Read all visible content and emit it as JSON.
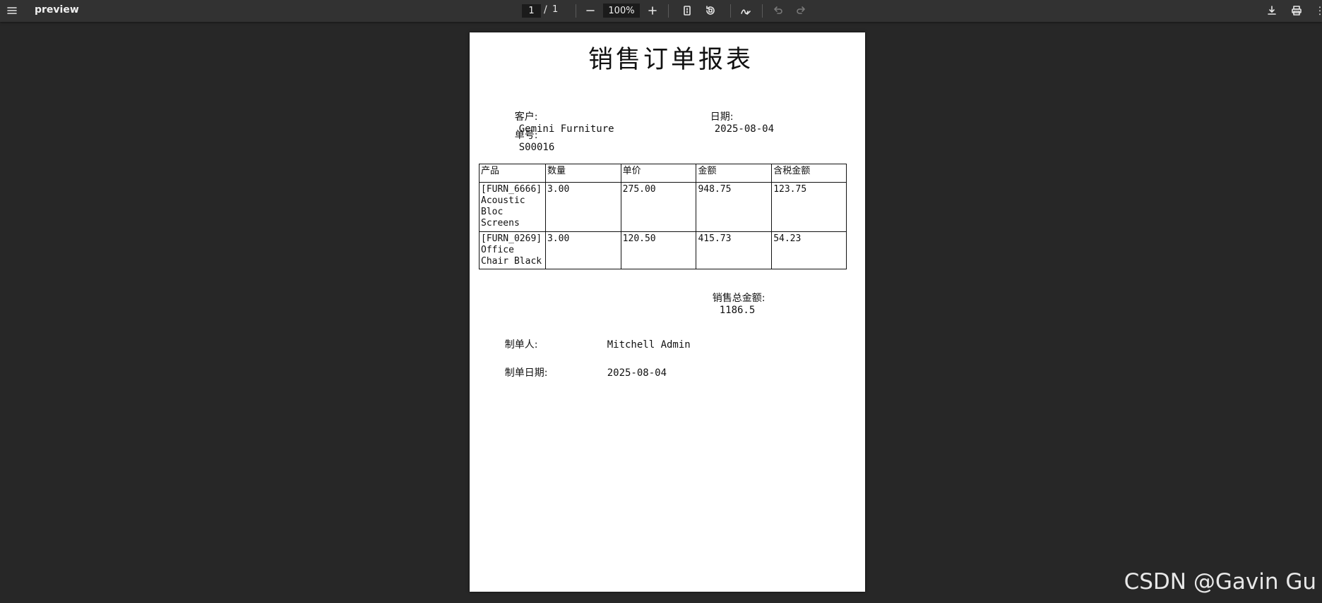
{
  "viewer": {
    "title": "preview",
    "current_page": "1",
    "page_separator": "/",
    "total_pages": "1",
    "zoom": "100%"
  },
  "document": {
    "title": "销售订单报表",
    "customer_label": "客户:",
    "customer_value": "Gemini Furniture",
    "date_label": "日期:",
    "date_value": "2025-08-04",
    "order_no_label": "单号:",
    "order_no_value": "S00016",
    "table": {
      "headers": [
        "产品",
        "数量",
        "单价",
        "金额",
        "含税金额"
      ],
      "rows": [
        [
          "[FURN_6666] Acoustic Bloc Screens",
          "3.00",
          "275.00",
          "948.75",
          "123.75"
        ],
        [
          "[FURN_0269] Office Chair Black",
          "3.00",
          "120.50",
          "415.73",
          "54.23"
        ]
      ]
    },
    "total_label": "销售总金额:",
    "total_value": "1186.5",
    "creator_label": "制单人:",
    "creator_value": "Mitchell Admin",
    "created_date_label": "制单日期:",
    "created_date_value": "2025-08-04"
  },
  "watermark": "CSDN @Gavin Gu"
}
